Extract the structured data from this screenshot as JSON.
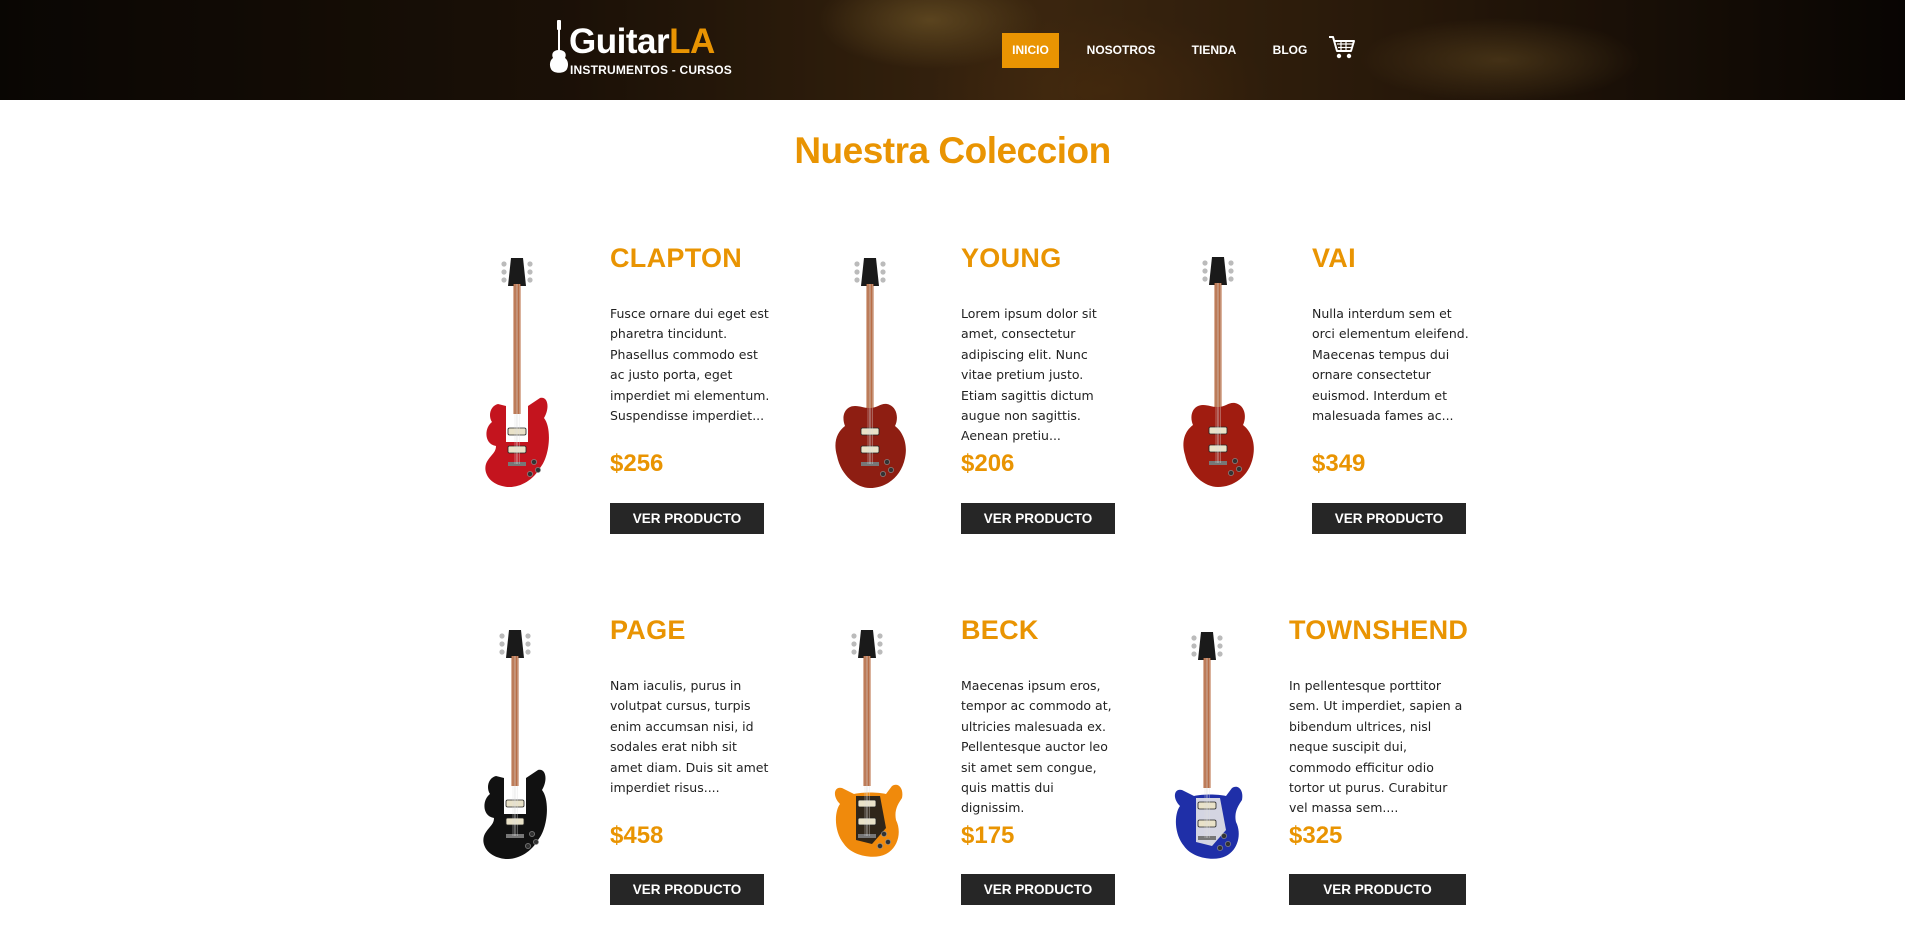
{
  "header": {
    "logo": {
      "name_part1": "Guitar",
      "name_part2": "LA",
      "tagline": "INSTRUMENTOS - CURSOS"
    },
    "nav": [
      {
        "label": "INICIO",
        "active": true
      },
      {
        "label": "NOSOTROS",
        "active": false
      },
      {
        "label": "TIENDA",
        "active": false
      },
      {
        "label": "BLOG",
        "active": false
      }
    ],
    "cart_icon": "cart-icon"
  },
  "main": {
    "title": "Nuestra Coleccion",
    "products": [
      {
        "name": "CLAPTON",
        "description": "Fusce ornare dui eget est pharetra tincidunt. Phasellus commodo est ac justo porta, eget imperdiet mi elementum. Suspendisse imperdiet...",
        "price": "$256",
        "button_label": "VER PRODUCTO",
        "guitar_color": "#c4141e",
        "guitar_style": "superstrat"
      },
      {
        "name": "YOUNG",
        "description": "Lorem ipsum dolor sit amet, consectetur adipiscing elit. Nunc vitae pretium justo. Etiam sagittis dictum augue non sagittis. Aenean pretiu...",
        "price": "$206",
        "button_label": "VER PRODUCTO",
        "guitar_color": "#8e1e12",
        "guitar_style": "single-cut"
      },
      {
        "name": "VAI",
        "description": "Nulla interdum sem et orci elementum eleifend. Maecenas tempus dui ornare consectetur euismod. Interdum et malesuada fames ac...",
        "price": "$349",
        "button_label": "VER PRODUCTO",
        "guitar_color": "#a01c10",
        "guitar_style": "single-cut"
      },
      {
        "name": "PAGE",
        "description": "Nam iaculis, purus in volutpat cursus, turpis enim accumsan nisi, id sodales erat nibh sit amet diam. Duis sit amet imperdiet risus....",
        "price": "$458",
        "button_label": "VER PRODUCTO",
        "guitar_color": "#111111",
        "guitar_style": "superstrat"
      },
      {
        "name": "BECK",
        "description": "Maecenas ipsum eros, tempor ac commodo at, ultricies malesuada ex. Pellentesque auctor leo sit amet sem congue, quis mattis dui dignissim.",
        "price": "$175",
        "button_label": "VER PRODUCTO",
        "guitar_color": "#f08a0c",
        "guitar_style": "strat"
      },
      {
        "name": "TOWNSHEND",
        "description": "In pellentesque porttitor sem. Ut imperdiet, sapien a bibendum ultrices, nisl neque suscipit dui, commodo efficitur odio tortor ut purus. Curabitur vel massa sem....",
        "price": "$325",
        "button_label": "VER PRODUCTO",
        "guitar_color": "#1f2fa8",
        "guitar_style": "strat"
      }
    ]
  }
}
